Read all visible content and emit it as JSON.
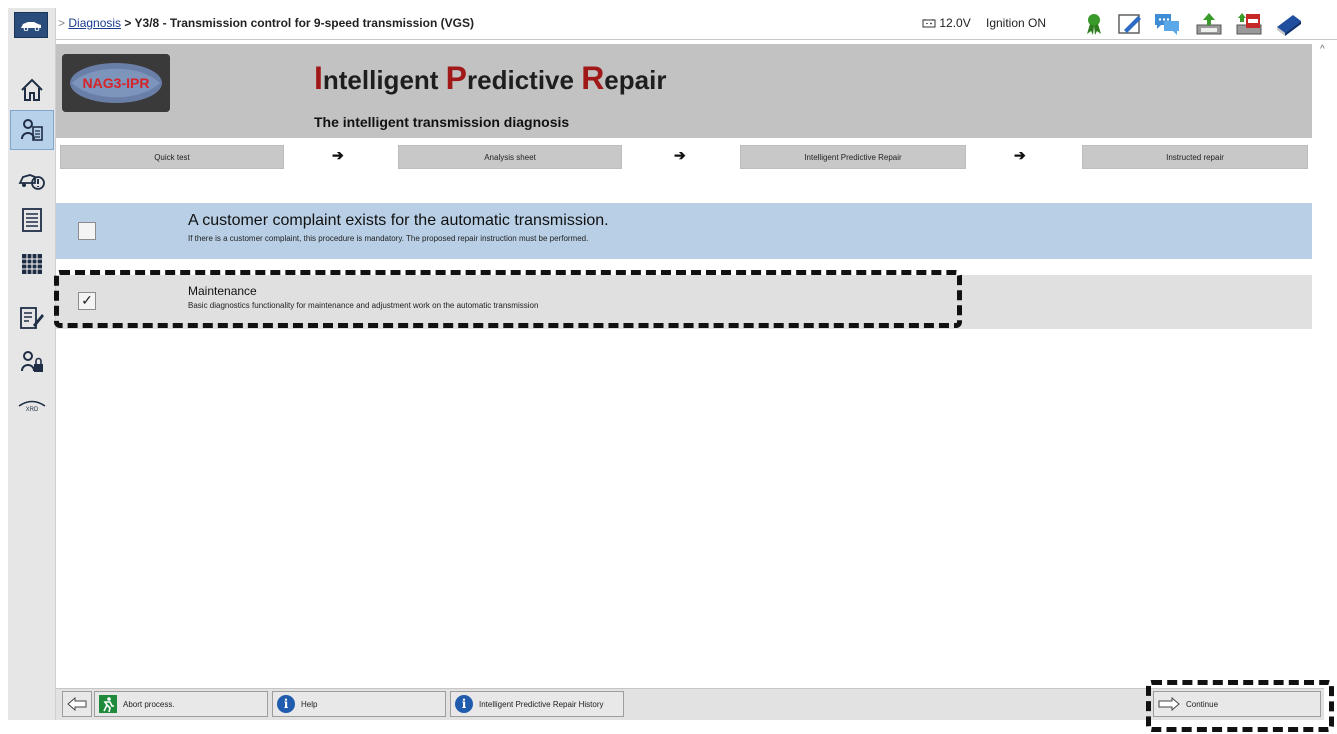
{
  "breadcrumb": {
    "prefix": ">",
    "link": "Diagnosis",
    "separator": ">",
    "current": "Y3/8 - Transmission control for 9-speed transmission (VGS)"
  },
  "status": {
    "battery": "12.0V",
    "ignition": "Ignition ON"
  },
  "banner": {
    "title_parts": [
      {
        "cap": "I",
        "rest": "ntelligent "
      },
      {
        "cap": "P",
        "rest": "redictive "
      },
      {
        "cap": "R",
        "rest": "epair"
      }
    ],
    "subtitle": "The intelligent transmission diagnosis",
    "logo_text": "NAG3-IPR"
  },
  "steps": [
    {
      "label": "Quick test"
    },
    {
      "label": "Analysis sheet"
    },
    {
      "label": "Intelligent Predictive Repair"
    },
    {
      "label": "Instructed repair"
    }
  ],
  "step_arrow": "➔",
  "options": [
    {
      "title": "A customer complaint exists for the automatic transmission.",
      "description": "If there is a customer complaint, this procedure is mandatory. The proposed repair instruction must be performed.",
      "checked": false,
      "mark": ""
    },
    {
      "title": "Maintenance",
      "description": "Basic diagnostics functionality for maintenance and adjustment work on the automatic transmission",
      "checked": true,
      "mark": "✓"
    }
  ],
  "footer": {
    "abort": "Abort process.",
    "help": "Help",
    "history": "Intelligent Predictive Repair History",
    "continue": "Continue"
  },
  "rail": {
    "xrd": "XRD"
  },
  "colors": {
    "accent_red": "#a01818",
    "complaint_bg": "#b8cfe5",
    "info_blue": "#1f5cae"
  }
}
